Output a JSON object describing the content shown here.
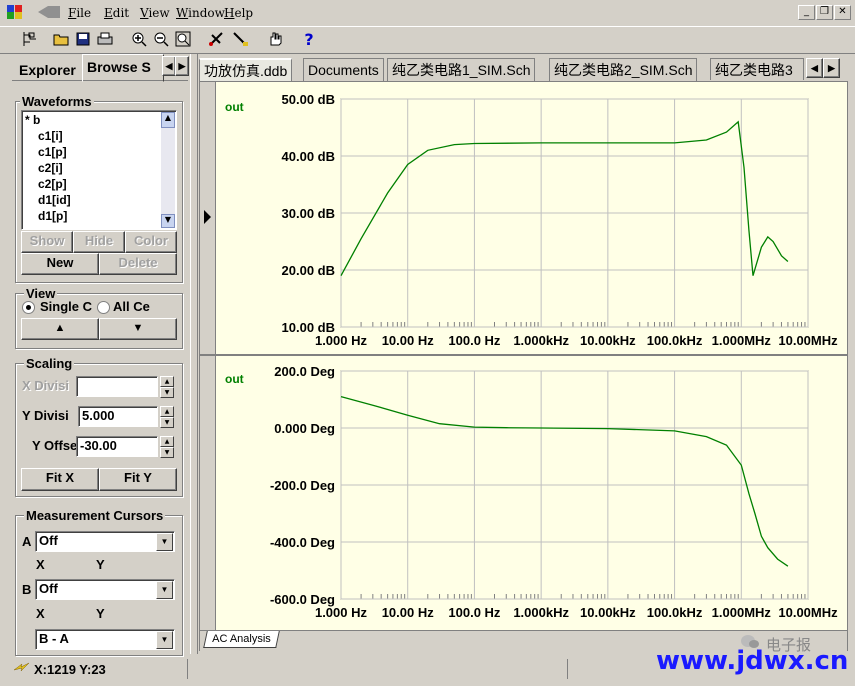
{
  "menu": {
    "items": [
      "File",
      "Edit",
      "View",
      "Window",
      "Help"
    ]
  },
  "toolbar": {
    "icons": [
      "sheet-icon",
      "open-folder-icon",
      "save-icon",
      "print-icon",
      "zoom-in-icon",
      "zoom-out-icon",
      "zoom-fit-icon",
      "probe-icon",
      "wire-icon",
      "hand-icon",
      "help-icon"
    ],
    "help_glyph": "?"
  },
  "left_tabs": {
    "explorer": "Explorer",
    "browse": "Browse S"
  },
  "waveforms": {
    "title": "Waveforms",
    "items": [
      "* b",
      "c1[i]",
      "c1[p]",
      "c2[i]",
      "c2[p]",
      "d1[id]",
      "d1[p]"
    ],
    "buttons": {
      "show": "Show",
      "hide": "Hide",
      "color": "Color",
      "new": "New",
      "delete": "Delete"
    }
  },
  "view": {
    "title": "View",
    "single": "Single C",
    "all": "All Ce"
  },
  "scaling": {
    "title": "Scaling",
    "x_div_label": "X Divisi",
    "x_div_value": "",
    "y_div_label": "Y Divisi",
    "y_div_value": "5.000",
    "y_off_label": "Y Offse",
    "y_off_value": "-30.00",
    "fitx": "Fit X",
    "fity": "Fit Y"
  },
  "cursors": {
    "title": "Measurement Cursors",
    "a_label": "A",
    "a_value": "Off",
    "b_label": "B",
    "b_value": "Off",
    "x": "X",
    "y": "Y",
    "diff_value": "B - A"
  },
  "doc_tabs": [
    "功放仿真.ddb",
    "Documents",
    "纯乙类电路1_SIM.Sch",
    "纯乙类电路2_SIM.Sch",
    "纯乙类电路3"
  ],
  "plot_tab": "AC Analysis",
  "status": {
    "coords": "X:1219 Y:23"
  },
  "watermark": {
    "brand": "电子报",
    "url": "www.jdwx.cn"
  },
  "colors": {
    "trace": "#008000",
    "plot_bg": "#ffffe6",
    "grid": "#c0c0c0"
  },
  "chart_data": [
    {
      "type": "line",
      "series_label": "out",
      "x_scale": "log",
      "x_ticks": [
        "1.000 Hz",
        "10.00 Hz",
        "100.0 Hz",
        "1.000kHz",
        "10.00kHz",
        "100.0kHz",
        "1.000MHz",
        "10.00MHz"
      ],
      "y_ticks": [
        "50.00 dB",
        "40.00 dB",
        "30.00 dB",
        "20.00 dB",
        "10.00 dB"
      ],
      "xlim": [
        1,
        10000000
      ],
      "ylim": [
        10,
        50
      ],
      "x": [
        1,
        2,
        5,
        10,
        20,
        50,
        100,
        1000,
        10000,
        100000,
        300000,
        600000,
        900000,
        1100000,
        1300000,
        1500000,
        2000000,
        2500000,
        3000000,
        4000000,
        5000000
      ],
      "y": [
        19,
        25.5,
        33.5,
        38.5,
        41,
        42,
        42.2,
        42.3,
        42.3,
        42.3,
        42.8,
        44.2,
        46,
        38,
        27,
        19,
        24,
        25.8,
        25,
        22.5,
        21.5
      ]
    },
    {
      "type": "line",
      "series_label": "out",
      "x_scale": "log",
      "x_ticks": [
        "1.000 Hz",
        "10.00 Hz",
        "100.0 Hz",
        "1.000kHz",
        "10.00kHz",
        "100.0kHz",
        "1.000MHz",
        "10.00MHz"
      ],
      "y_ticks": [
        "200.0 Deg",
        "0.000 Deg",
        "-200.0 Deg",
        "-400.0 Deg",
        "-600.0 Deg"
      ],
      "xlim": [
        1,
        10000000
      ],
      "ylim": [
        -600,
        200
      ],
      "x": [
        1,
        3,
        10,
        30,
        100,
        300,
        1000,
        10000,
        100000,
        300000,
        600000,
        1000000,
        1300000,
        1600000,
        2000000,
        2500000,
        3500000,
        5000000
      ],
      "y": [
        110,
        80,
        45,
        15,
        3,
        1,
        0,
        -2,
        -10,
        -30,
        -60,
        -130,
        -230,
        -300,
        -380,
        -420,
        -460,
        -485
      ]
    }
  ]
}
